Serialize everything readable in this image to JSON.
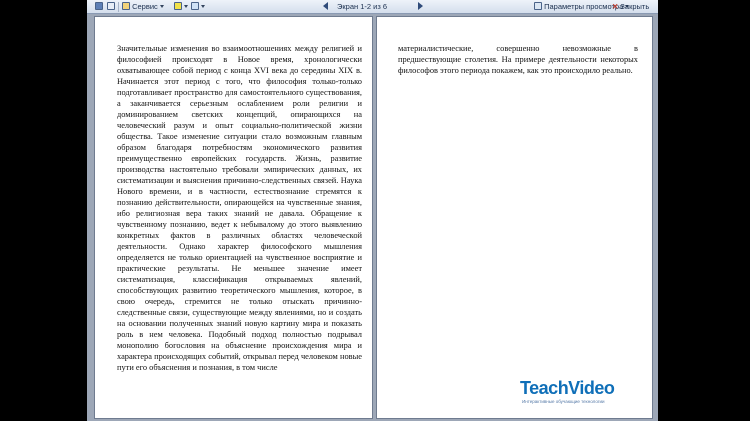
{
  "toolbar": {
    "service_label": "Сервис",
    "screen_label": "Экран 1-2 из 6",
    "view_params_label": "Параметры просмотра",
    "close_label": "Закрыть"
  },
  "pages": {
    "left": "Значительные изменения во взаимоотношениях между религией и философией происходят в Новое время, хронологически охватывающее собой период с конца XVI века до середины XIX в. Начинается этот период с того, что философия только-только подготавливает пространство для самостоятельного существования, а заканчивается серьезным ослаблением роли религии и доминированием светских концепций, опирающихся на человеческий разум и опыт социально-политической жизни общества. Такое изменение ситуации стало возможным главным образом благодаря потребностям экономического развития преимущественно европейских государств. Жизнь, развитие производства настоятельно требовали эмпирических данных, их систематизации и выяснения причинно-следственных связей. Наука Нового времени, и в частности, естествознание стремятся к познанию действительности, опирающейся на чувственные знания, ибо религиозная вера таких знаний не давала. Обращение к чувственному познанию, ведет к небывалому до этого выявлению конкретных фактов в различных областях человеческой деятельности. Однако характер философского мышления определяется не только ориентацией на чувственное восприятие и практические результаты. Не меньшее значение имеет систематизация, классификация открываемых явлений, способствующих развитию теоретического мышления, которое, в свою очередь, стремится не только отыскать причинно-следственные связи, существующие между явлениями, но и создать на основании полученных знаний новую картину мира и показать роль в нем человека. Подобный подход полностью подрывал монополию богословия на объяснение происхождения мира и характера происходящих событий, открывал перед человеком новые пути его объяснения и познания, в том числе",
    "right": "материалистические, совершенно невозможные в предшествующие столетия. На примере деятельности некоторых философов этого периода покажем, как это происходило реально."
  },
  "watermark": {
    "brand": "TeachVideo",
    "tagline": "Интерактивные обучающие технологии"
  }
}
